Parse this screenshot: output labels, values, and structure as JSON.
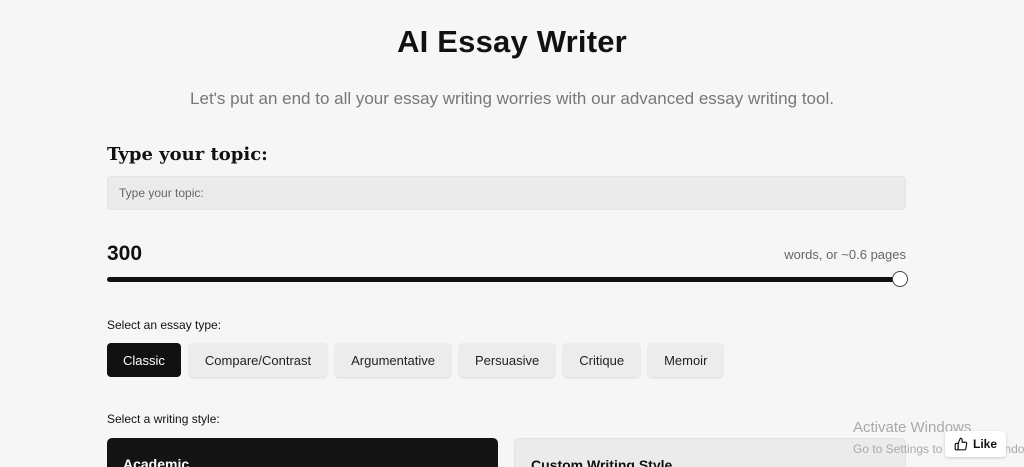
{
  "header": {
    "title": "AI Essay Writer",
    "subtitle": "Let's put an end to all your essay writing worries with our advanced essay writing tool."
  },
  "topic": {
    "label": "Type your topic:",
    "placeholder": "Type your topic:"
  },
  "length": {
    "words": "300",
    "pages_note": "words, or ~0.6 pages",
    "slider_fraction": 1.0
  },
  "essay_type": {
    "label": "Select an essay type:",
    "options": [
      "Classic",
      "Compare/Contrast",
      "Argumentative",
      "Persuasive",
      "Critique",
      "Memoir"
    ],
    "selected": "Classic"
  },
  "writing_style": {
    "label": "Select a writing style:",
    "options": [
      "Academic",
      "Custom Writing Style"
    ],
    "selected": "Academic"
  },
  "overlay": {
    "watermark_title": "Activate Windows",
    "watermark_sub": "Go to Settings to activate Windows.",
    "like_label": "Like",
    "like_icon": "thumbs-up-icon"
  },
  "colors": {
    "accent": "#111111",
    "background": "#f6f6f6"
  }
}
